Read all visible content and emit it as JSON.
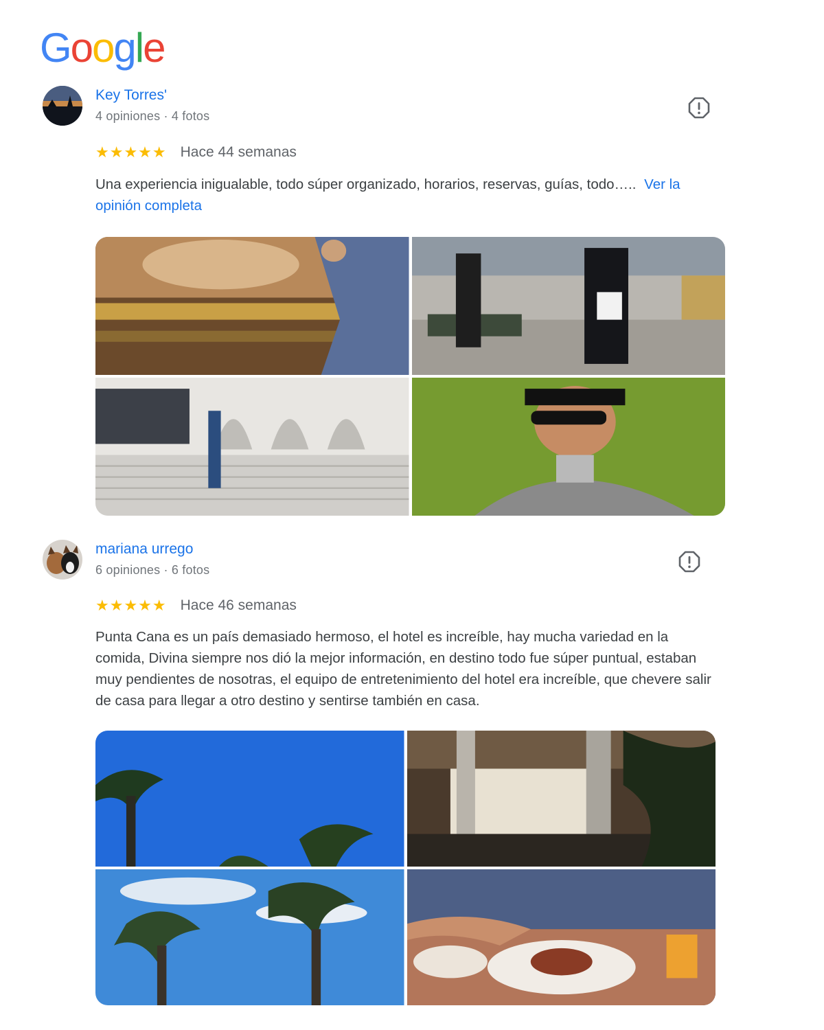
{
  "logo": {
    "letters": [
      "G",
      "o",
      "o",
      "g",
      "l",
      "e"
    ],
    "colors": [
      "#4285f4",
      "#ea4335",
      "#fbbc04",
      "#4285f4",
      "#34a853",
      "#ea4335"
    ]
  },
  "colors": {
    "link": "#1a73e8",
    "star": "#fbbc04",
    "text": "#3c4043",
    "muted": "#70757a"
  },
  "reviews": [
    {
      "name": "Key Torres'",
      "meta": "4 opiniones · 4 fotos",
      "stars": "★★★★★",
      "rating": 5,
      "ago": "Hace 44 semanas",
      "text": "Una experiencia inigualable, todo súper organizado, horarios, reservas, guías, todo…..",
      "more": "Ver la opinión completa",
      "flag_icon": "report-flag-icon",
      "photos": [
        "palace-ceiling-photo",
        "city-street-photo",
        "white-building-steps-photo",
        "selfie-on-grass-photo"
      ]
    },
    {
      "name": "mariana urrego",
      "meta": "6 opiniones · 6 fotos",
      "stars": "★★★★★",
      "rating": 5,
      "ago": "Hace 46 semanas",
      "text": "Punta Cana es un país demasiado hermoso, el hotel es increíble, hay mucha variedad en la comida, Divina siempre nos dió la mejor información, en destino todo fue súper puntual, estaban muy pendientes de nosotras, el equipo de entretenimiento del hotel era increíble, que chevere salir de casa para llegar a otro destino y sentirse también en casa.",
      "more": "",
      "flag_icon": "report-flag-icon",
      "photos": [
        "palm-trees-sky-photo",
        "hotel-restaurant-photo",
        "palm-trees-clouds-photo",
        "dinner-plate-photo"
      ]
    }
  ]
}
